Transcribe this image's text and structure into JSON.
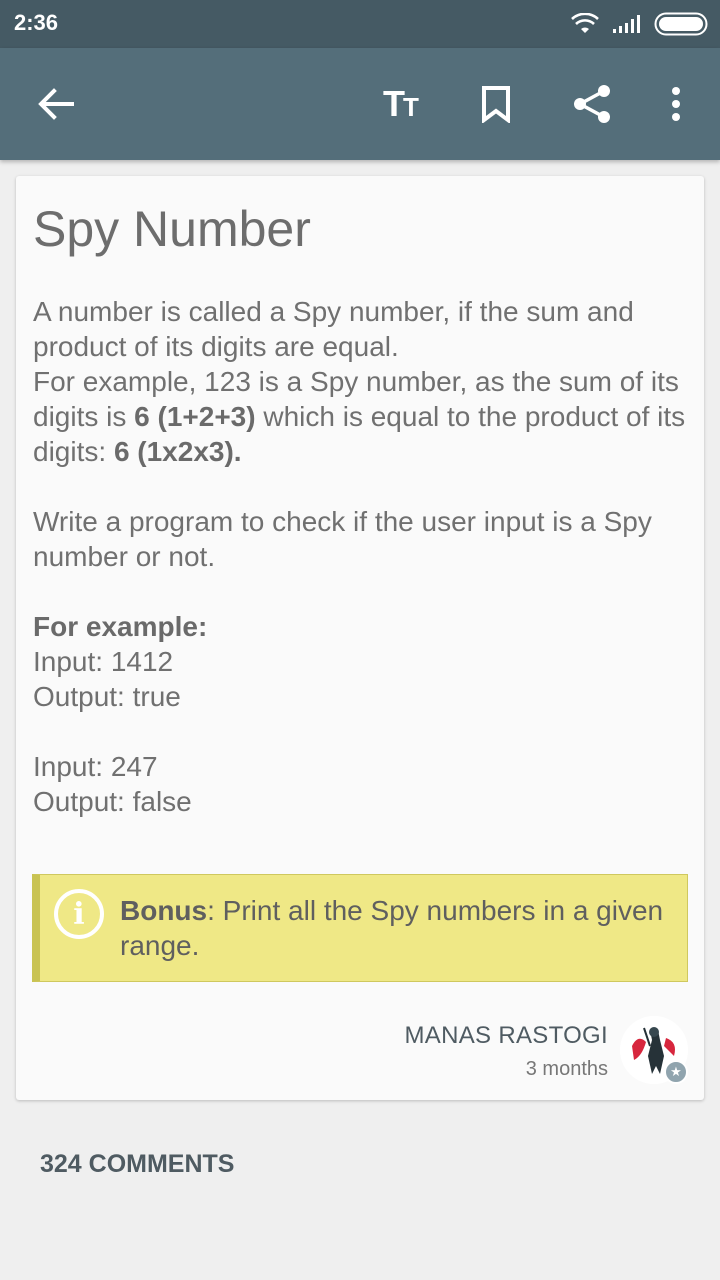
{
  "status_bar": {
    "time": "2:36"
  },
  "app_bar": {
    "text_size_icon": "text-size-icon",
    "text_size_label_big": "T",
    "text_size_label_small": "T",
    "icons": [
      "back-arrow-icon",
      "text-size-icon",
      "bookmark-icon",
      "share-icon",
      "more-vert-icon"
    ]
  },
  "article": {
    "title": "Spy Number",
    "p1": "A number is called a Spy number, if the sum and product of its digits are equal.",
    "p2_a": "For example, 123 is a Spy number, as the sum of its digits is ",
    "p2_b": "6 (1+2+3)",
    "p2_c": " which is equal to the product of its digits: ",
    "p2_d": "6 (1x2x3).",
    "p3": "Write a program to check if the user input is a Spy number or not.",
    "example_heading": "For example:",
    "ex1_input": "Input: 1412",
    "ex1_output": "Output: true",
    "ex2_input": "Input: 247",
    "ex2_output": "Output: false",
    "bonus_label": "Bonus",
    "bonus_text": ": Print all the Spy numbers in a given range."
  },
  "author": {
    "name": "MANAS RASTOGI",
    "time": "3 months"
  },
  "comments": {
    "label": "324 COMMENTS"
  },
  "colors": {
    "status_bar": "#455a64",
    "app_bar": "#546e7a",
    "bonus_bg": "#efe886",
    "bonus_border": "#c9c352"
  }
}
